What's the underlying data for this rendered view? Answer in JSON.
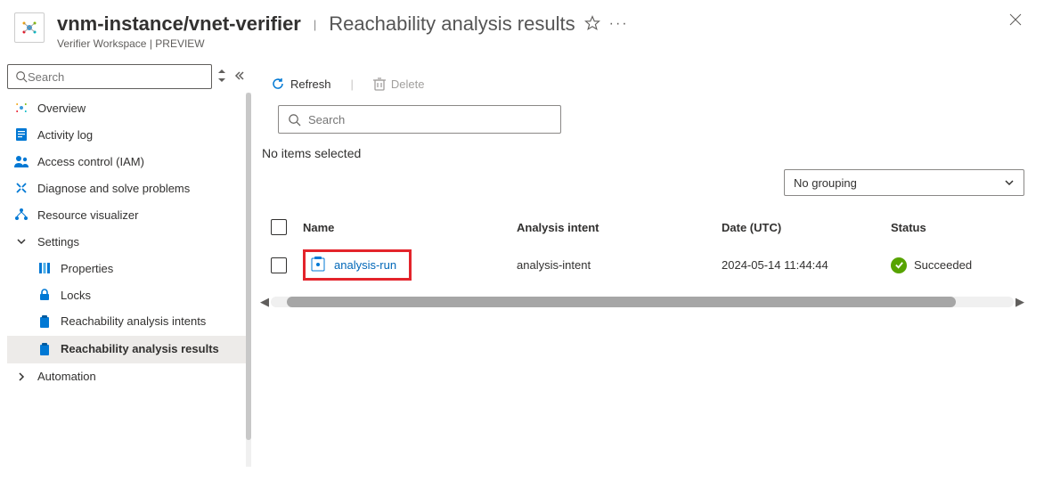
{
  "header": {
    "breadcrumb": "vnm-instance/vnet-verifier",
    "section": "Reachability analysis results",
    "subtitle": "Verifier Workspace | PREVIEW"
  },
  "sidebar": {
    "search_placeholder": "Search",
    "items": {
      "overview": "Overview",
      "activity_log": "Activity log",
      "access_control": "Access control (IAM)",
      "diagnose": "Diagnose and solve problems",
      "resource_visualizer": "Resource visualizer",
      "settings": "Settings",
      "properties": "Properties",
      "locks": "Locks",
      "reach_intents": "Reachability analysis intents",
      "reach_results": "Reachability analysis results",
      "automation": "Automation"
    }
  },
  "toolbar": {
    "refresh": "Refresh",
    "delete": "Delete"
  },
  "content": {
    "search_placeholder": "Search",
    "no_items": "No items selected",
    "grouping": "No grouping"
  },
  "table": {
    "columns": {
      "name": "Name",
      "intent": "Analysis intent",
      "date": "Date (UTC)",
      "status": "Status"
    },
    "rows": [
      {
        "name": "analysis-run",
        "intent": "analysis-intent",
        "date": "2024-05-14 11:44:44",
        "status": "Succeeded"
      }
    ]
  }
}
